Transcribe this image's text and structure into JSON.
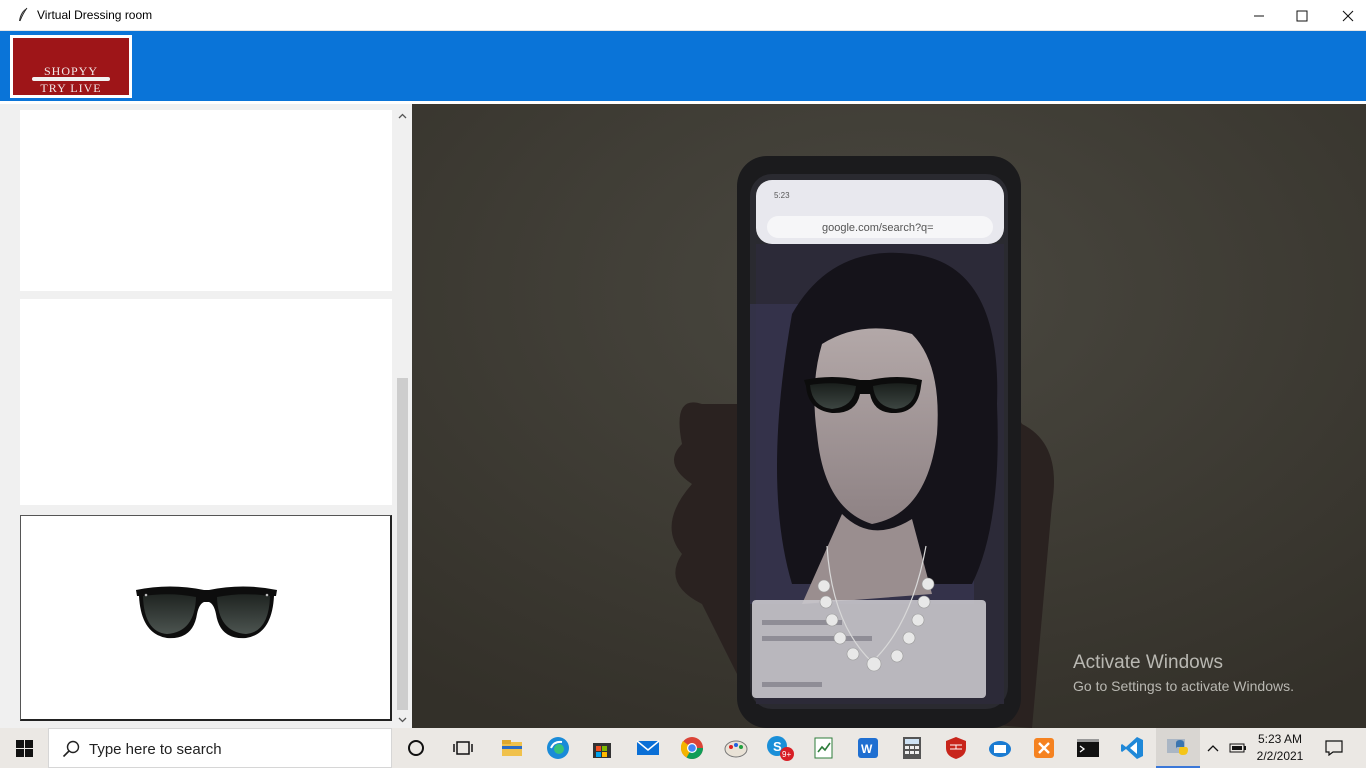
{
  "window": {
    "title": "Virtual Dressing room",
    "minimize_icon": "minimize-icon",
    "maximize_icon": "maximize-icon",
    "close_icon": "close-icon"
  },
  "header": {
    "logo_top": "SHOPYY",
    "logo_bottom": "TRY LIVE",
    "brand_color": "#0a74d8",
    "logo_color": "#9e1518"
  },
  "products": {
    "items": [
      {
        "name": "",
        "icon": "empty-slot"
      },
      {
        "name": "",
        "icon": "empty-slot"
      },
      {
        "name": "",
        "icon": "sunglasses-icon"
      }
    ]
  },
  "scrollbar": {
    "position_fraction": 0.44
  },
  "camera": {
    "phone_url": "google.com/search?q=",
    "phone_time": "5:23",
    "overlay_items": [
      "sunglasses",
      "necklace"
    ],
    "activate_title": "Activate Windows",
    "activate_sub": "Go to Settings to activate Windows."
  },
  "taskbar": {
    "search_placeholder": "Type here to search",
    "skype_badge": "9+",
    "time": "5:23 AM",
    "date": "2/2/2021",
    "apps": [
      "cortana-icon",
      "task-view-icon",
      "file-explorer-icon",
      "edge-icon",
      "store-icon",
      "mail-icon",
      "chrome-icon",
      "paint-icon",
      "skype-icon",
      "editor-icon",
      "wps-icon",
      "calculator-icon",
      "firewall-icon",
      "outlook-icon",
      "xampp-icon",
      "terminal-icon",
      "vscode-icon",
      "python-icon"
    ]
  }
}
